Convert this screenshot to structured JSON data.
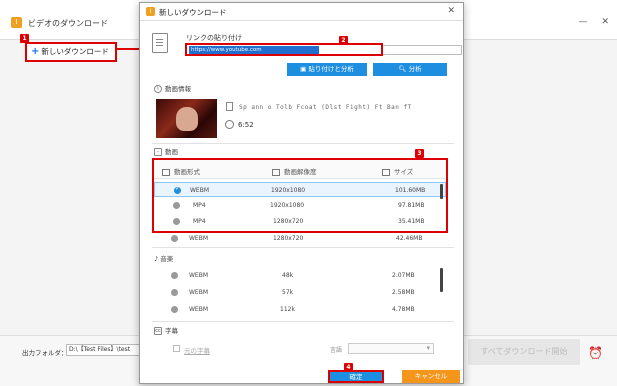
{
  "app": {
    "logo_text": "I",
    "title": "ビデオのダウンロード",
    "new_download_label": "新しいダウンロード",
    "output_folder_label": "出力フォルダ：",
    "output_folder_value": "D:\\【Test Files】\\test",
    "download_all_label": "すべてダウンロード開始",
    "window_controls": [
      "—",
      "✕"
    ]
  },
  "dialog": {
    "logo_text": "I",
    "title": "新しいダウンロード",
    "close_label": "✕",
    "link_label": "リンクの貼り付け",
    "url_value": "https://www.youtube.com",
    "paste_analyze_label": "貼り付けと分析",
    "analyze_label": "分析",
    "video_info_label": "動画情報",
    "video_title": "Sp ann o Tolb Fcoat (Dlst Fight) Ft Ban fT",
    "duration": "6:52",
    "video_section_label": "動画",
    "col_format": "動画形式",
    "col_resolution": "動画解像度",
    "col_size": "サイズ",
    "video_rows": [
      {
        "format": "WEBM",
        "resolution": "1920x1080",
        "size": "101.60MB",
        "selected": true
      },
      {
        "format": "MP4",
        "resolution": "1920x1080",
        "size": "97.81MB",
        "selected": false
      },
      {
        "format": "MP4",
        "resolution": "1280x720",
        "size": "35.41MB",
        "selected": false
      },
      {
        "format": "WEBM",
        "resolution": "1280x720",
        "size": "42.46MB",
        "selected": false
      }
    ],
    "audio_section_label": "音楽",
    "audio_rows": [
      {
        "format": "WEBM",
        "bitrate": "48k",
        "size": "2.07MB"
      },
      {
        "format": "WEBM",
        "bitrate": "57k",
        "size": "2.58MB"
      },
      {
        "format": "WEBM",
        "bitrate": "112k",
        "size": "4.78MB"
      }
    ],
    "subtitle_section_label": "字幕",
    "original_subtitle_label": "元の字幕",
    "language_label": "言語",
    "ok_label": "確定",
    "cancel_label": "キャンセル"
  },
  "badges": [
    "1",
    "2",
    "3",
    "4"
  ],
  "colors": {
    "accent_blue": "#1e8fe0",
    "highlight_red": "#dd0000",
    "cancel_orange": "#f5961c",
    "logo_orange": "#f0a020"
  }
}
